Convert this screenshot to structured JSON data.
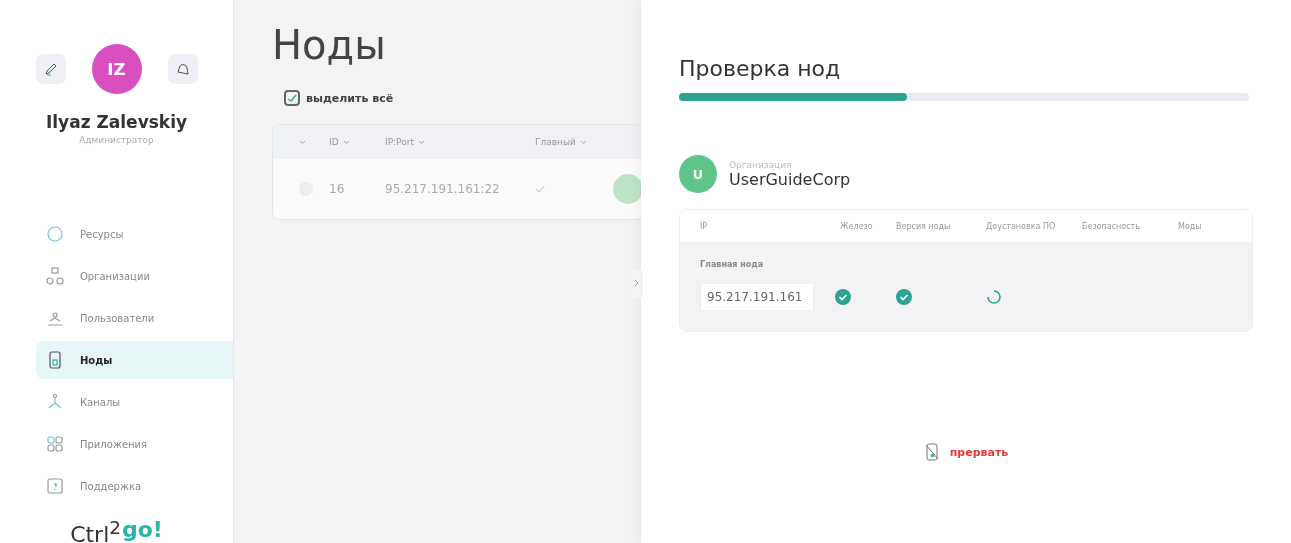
{
  "profile": {
    "initials": "IZ",
    "name": "Ilyaz Zalevskiy",
    "role": "Администратор"
  },
  "sidebar": {
    "items": [
      {
        "label": "Ресурсы",
        "selected": false
      },
      {
        "label": "Организации",
        "selected": false
      },
      {
        "label": "Пользователи",
        "selected": false
      },
      {
        "label": "Ноды",
        "selected": true
      },
      {
        "label": "Каналы",
        "selected": false
      },
      {
        "label": "Приложения",
        "selected": false
      },
      {
        "label": "Поддержка",
        "selected": false
      }
    ]
  },
  "logo": {
    "text": "Ctrl$^{2}$",
    "accent": "go!"
  },
  "page": {
    "title": "Ноды",
    "select_all": {
      "label": "выделить всё",
      "checked": true
    },
    "table": {
      "columns": [
        "ID",
        "IP:Port",
        "Главный"
      ],
      "rows": [
        {
          "id": "16",
          "ip_port": "95.217.191.161:22",
          "main": true,
          "selected": false
        }
      ]
    }
  },
  "panel": {
    "title": "Проверка нод",
    "progress": {
      "level": 0.4
    },
    "org": {
      "initials": "U",
      "caption": "Организация",
      "name": "UserGuideCorp"
    },
    "columns": [
      "IP",
      "Железо",
      "Версия ноды",
      "Доустановка ПО",
      "Безопасность",
      "Моды"
    ],
    "group": "Главная нода",
    "node": {
      "ip": "95.217.191.161",
      "statuses": [
        {
          "kind": "done"
        },
        {
          "kind": "done"
        },
        {
          "kind": "loading"
        },
        {
          "kind": "none"
        },
        {
          "kind": "none"
        }
      ]
    },
    "abort": "прервать"
  }
}
